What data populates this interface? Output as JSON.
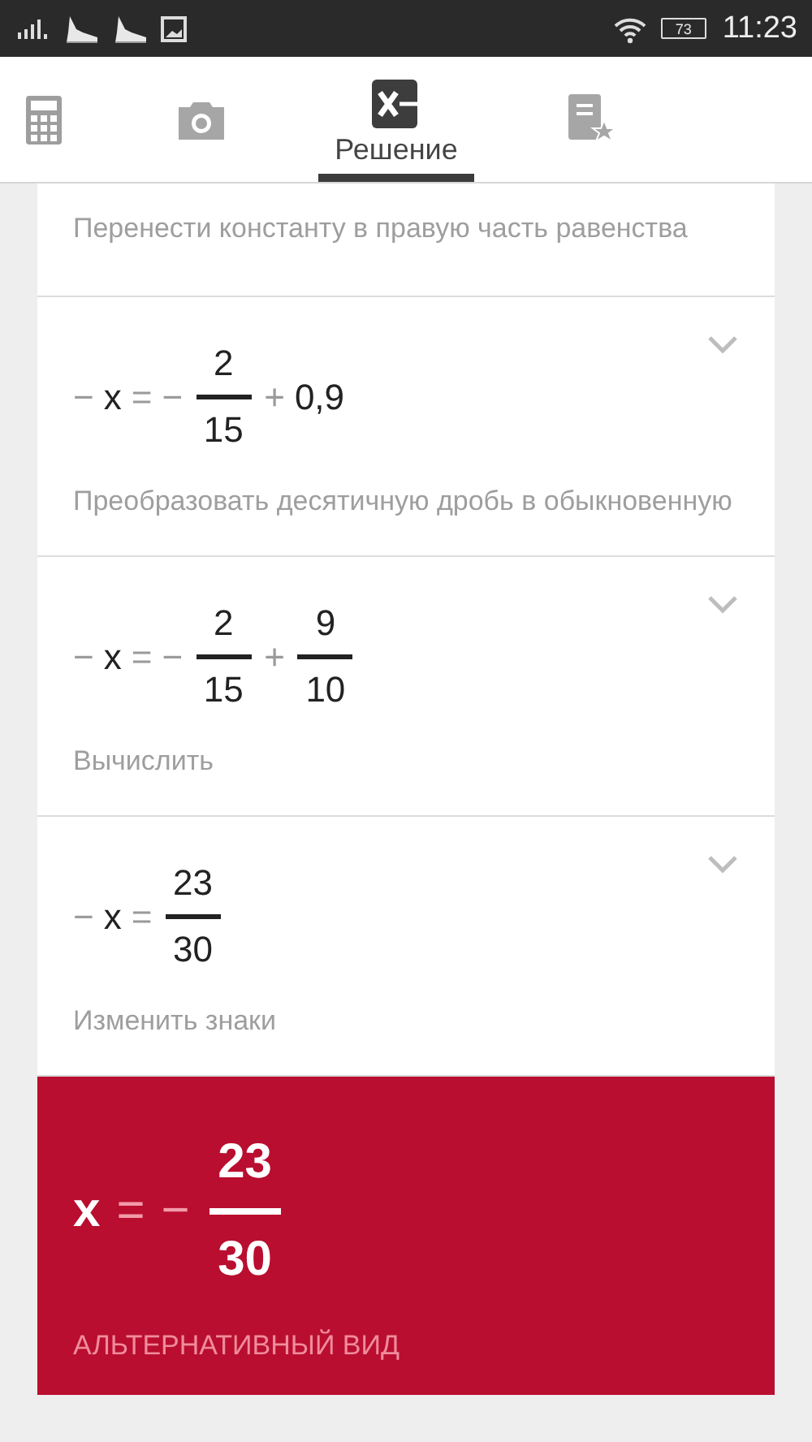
{
  "status_bar": {
    "battery": "73",
    "time": "11:23"
  },
  "tabs": [
    {
      "kind": "calculator",
      "selected": false
    },
    {
      "kind": "camera",
      "selected": false
    },
    {
      "kind": "solution",
      "label": "Решение",
      "selected": true
    },
    {
      "kind": "notebook",
      "selected": false
    }
  ],
  "steps": [
    {
      "description": "Перенести константу в правую часть равенства"
    },
    {
      "expression": [
        {
          "kind": "sign",
          "text": "−"
        },
        {
          "kind": "term",
          "text": "x"
        },
        {
          "kind": "sign",
          "text": "="
        },
        {
          "kind": "sign",
          "text": "−"
        },
        {
          "kind": "frac",
          "numerator": "2",
          "denominator": "15"
        },
        {
          "kind": "sign",
          "text": "+"
        },
        {
          "kind": "term",
          "text": "0,9"
        }
      ],
      "expanded": false,
      "description": "Преобразовать десятичную дробь в обыкновенную"
    },
    {
      "expression": [
        {
          "kind": "sign",
          "text": "−"
        },
        {
          "kind": "term",
          "text": "x"
        },
        {
          "kind": "sign",
          "text": "="
        },
        {
          "kind": "sign",
          "text": "−"
        },
        {
          "kind": "frac",
          "numerator": "2",
          "denominator": "15"
        },
        {
          "kind": "sign",
          "text": "+"
        },
        {
          "kind": "frac",
          "numerator": "9",
          "denominator": "10"
        }
      ],
      "expanded": false,
      "description": "Вычислить"
    },
    {
      "expression": [
        {
          "kind": "sign",
          "text": "−"
        },
        {
          "kind": "term",
          "text": "x"
        },
        {
          "kind": "sign",
          "text": "="
        },
        {
          "kind": "frac",
          "numerator": "23",
          "denominator": "30"
        }
      ],
      "expanded": false,
      "description": "Изменить знаки"
    }
  ],
  "result": {
    "expression": [
      {
        "kind": "term",
        "text": "x"
      },
      {
        "kind": "sign",
        "text": "="
      },
      {
        "kind": "sign",
        "text": "−"
      },
      {
        "kind": "frac",
        "numerator": "23",
        "denominator": "30"
      }
    ],
    "link": "АЛЬТЕРНАТИВНЫЙ ВИД"
  }
}
